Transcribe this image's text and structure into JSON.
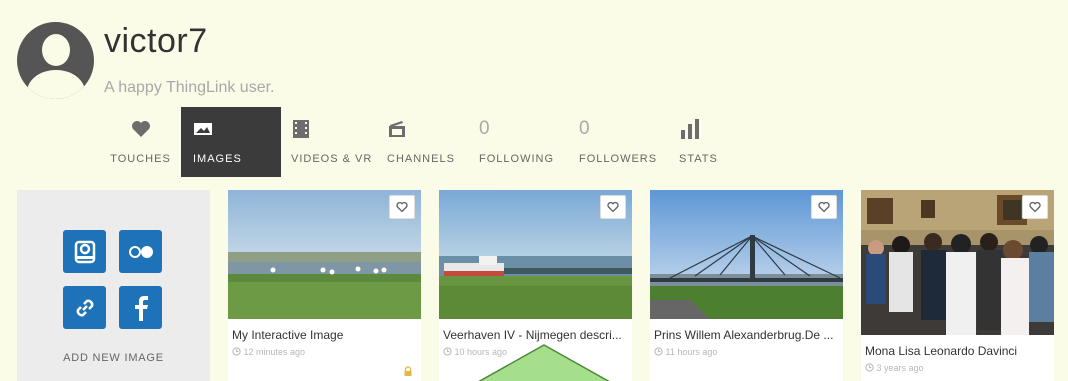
{
  "profile": {
    "username": "victor7",
    "tagline": "A happy ThingLink user."
  },
  "tabs": [
    {
      "label": "TOUCHES",
      "icon": "heart-icon"
    },
    {
      "label": "IMAGES",
      "icon": "image-icon",
      "active": true
    },
    {
      "label": "VIDEOS & VR",
      "icon": "film-icon"
    },
    {
      "label": "CHANNELS",
      "icon": "channel-icon"
    },
    {
      "label": "FOLLOWING",
      "count": "0"
    },
    {
      "label": "FOLLOWERS",
      "count": "0"
    },
    {
      "label": "STATS",
      "icon": "bar-chart-icon"
    }
  ],
  "add_panel": {
    "label": "ADD NEW IMAGE",
    "services": [
      "upload-drive-icon",
      "flickr-icon",
      "link-icon",
      "facebook-icon"
    ]
  },
  "images": [
    {
      "title": "My Interactive Image",
      "time": "12 minutes ago",
      "locked": true
    },
    {
      "title": "Veerhaven IV - Nijmegen descri...",
      "time": "10 hours ago"
    },
    {
      "title": "Prins Willem Alexanderbrug.De ...",
      "time": "11 hours ago"
    },
    {
      "title": "Mona Lisa Leonardo Davinci",
      "time": "3 years ago"
    }
  ],
  "colors": {
    "background": "#fbfce8",
    "active_tab": "#3b3b3b",
    "service_blue": "#1e72b8",
    "arrow_green": "#a6df8c"
  }
}
